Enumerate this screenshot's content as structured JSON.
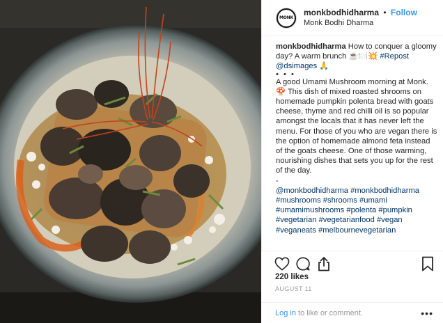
{
  "post": {
    "photo_alt": "Mushrooms on polenta bread with goats cheese, thyme and red chilli oil"
  },
  "header": {
    "avatar_text": "MONK",
    "username": "monkbodhidharma",
    "separator": "•",
    "follow_label": "Follow",
    "subtitle": "Monk Bodhi Dharma"
  },
  "caption": {
    "username": "monkbodhidharma",
    "intro": " How to conquer a gloomy day? A warm brunch ☕🍽️💥",
    "repost_tag": "#Repost",
    "repost_handle": "@dsimages",
    "repost_emoji": " 🙏",
    "dots": "• • •",
    "body": "A good Umami Mushroom morning at Monk. 🍄 This dish of mixed roasted shrooms on homemade pumpkin polenta bread with goats cheese, thyme and red chilli oil is so popular amongst the locals that it has never left the menu. For those of you who are vegan there is the option of homemade almond feta instead of the goats cheese. One of those warming, nourishing dishes that sets you up for the rest of the day.",
    "dash": "-",
    "hashtags": [
      "@monkbodhidharma",
      "#monkbodhidharma",
      "#mushrooms",
      "#shrooms",
      "#umami",
      "#umamimushrooms",
      "#polenta",
      "#pumpkin",
      "#vegetarian",
      "#vegetarianfood",
      "#vegan",
      "#veganeats",
      "#melbournevegetarian"
    ]
  },
  "actions": {
    "icons": [
      "heart-icon",
      "comment-icon",
      "share-icon",
      "bookmark-icon"
    ],
    "likes": "220 likes",
    "date": "AUGUST 11",
    "login_link": "Log in",
    "login_rest": " to like or comment.",
    "more": "•••"
  },
  "colors": {
    "link": "#3897f0",
    "hashtag": "#003569",
    "text": "#262626",
    "muted": "#999999",
    "border": "#efefef"
  }
}
